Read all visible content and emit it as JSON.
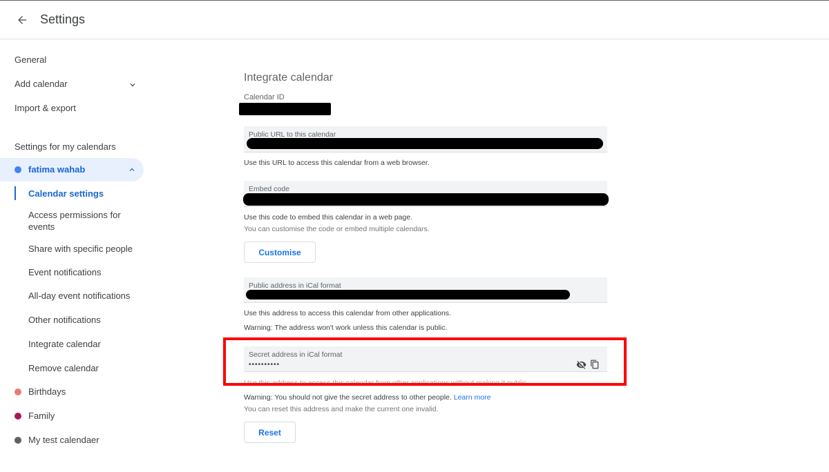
{
  "header": {
    "title": "Settings",
    "back_icon": "arrow-back-icon"
  },
  "sidebar": {
    "general": "General",
    "add_calendar": "Add calendar",
    "import_export": "Import & export",
    "section_title": "Settings for my calendars",
    "active_calendar": {
      "name": "fatima wahab",
      "color": "#4285f4"
    },
    "sub_items": [
      "Calendar settings",
      "Access permissions for events",
      "Share with specific people",
      "Event notifications",
      "All-day event notifications",
      "Other notifications",
      "Integrate calendar",
      "Remove calendar"
    ],
    "other_calendars": [
      {
        "name": "Birthdays",
        "color": "#e67c73"
      },
      {
        "name": "Family",
        "color": "#ad1457"
      },
      {
        "name": "My test calendaer",
        "color": "#616161"
      }
    ]
  },
  "main": {
    "title": "Integrate calendar",
    "calendar_id_label": "Calendar ID",
    "public_url": {
      "label": "Public URL to this calendar",
      "help": "Use this URL to access this calendar from a web browser."
    },
    "embed": {
      "label": "Embed code",
      "help1": "Use this code to embed this calendar in a web page.",
      "help2": "You can customise the code or embed multiple calendars.",
      "button": "Customise"
    },
    "public_ical": {
      "label": "Public address in iCal format",
      "help1": "Use this address to access this calendar from other applications.",
      "help2": "Warning: The address won't work unless this calendar is public."
    },
    "secret_ical": {
      "label": "Secret address in iCal format",
      "value": "••••••••••",
      "help1": "Use this address to access this calendar from other applications without making it public.",
      "warning": "Warning: You should not give the secret address to other people.",
      "learn_more": "Learn more",
      "reset_help": "You can reset this address and make the current one invalid.",
      "button": "Reset"
    }
  },
  "colors": {
    "accent": "#1a73e8",
    "highlight": "#ff0000",
    "active_bg": "#e8f0fe"
  }
}
